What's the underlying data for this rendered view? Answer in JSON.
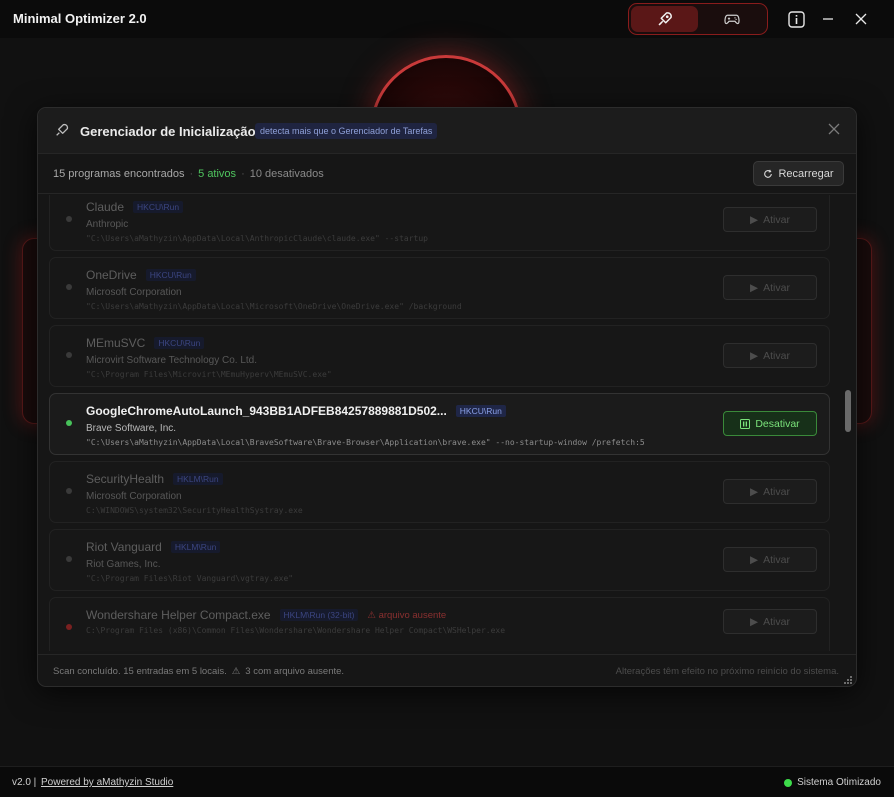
{
  "window": {
    "title": "Minimal Optimizer 2.0",
    "mode_icons": [
      "rocket-icon",
      "gamepad-icon"
    ],
    "window_controls": [
      "info-icon",
      "minimize-icon",
      "close-icon"
    ]
  },
  "modal": {
    "title": "Gerenciador de Inicialização",
    "tag": "detecta mais que o Gerenciador de Tarefas",
    "summary": {
      "found": "15 programas encontrados",
      "separator": "·",
      "active": "5 ativos",
      "inactive": "10 desativados"
    },
    "reload_label": "Recarregar",
    "items": [
      {
        "name": "Claude",
        "location": "HKCU\\Run",
        "vendor": "Anthropic",
        "path": "\"C:\\Users\\aMathyzin\\AppData\\Local\\AnthropicClaude\\claude.exe\" --startup",
        "enabled": false,
        "missing": false,
        "button": "Ativar"
      },
      {
        "name": "OneDrive",
        "location": "HKCU\\Run",
        "vendor": "Microsoft Corporation",
        "path": "\"C:\\Users\\aMathyzin\\AppData\\Local\\Microsoft\\OneDrive\\OneDrive.exe\" /background",
        "enabled": false,
        "missing": false,
        "button": "Ativar"
      },
      {
        "name": "MEmuSVC",
        "location": "HKCU\\Run",
        "vendor": "Microvirt Software Technology Co. Ltd.",
        "path": "\"C:\\Program Files\\Microvirt\\MEmuHyperv\\MEmuSVC.exe\"",
        "enabled": false,
        "missing": false,
        "button": "Ativar"
      },
      {
        "name": "GoogleChromeAutoLaunch_943BB1ADFEB84257889881D502...",
        "location": "HKCU\\Run",
        "vendor": "Brave Software, Inc.",
        "path": "\"C:\\Users\\aMathyzin\\AppData\\Local\\BraveSoftware\\Brave-Browser\\Application\\brave.exe\" --no-startup-window /prefetch:5",
        "enabled": true,
        "missing": false,
        "button": "Desativar"
      },
      {
        "name": "SecurityHealth",
        "location": "HKLM\\Run",
        "vendor": "Microsoft Corporation",
        "path": "C:\\WINDOWS\\system32\\SecurityHealthSystray.exe",
        "enabled": false,
        "missing": false,
        "button": "Ativar"
      },
      {
        "name": "Riot Vanguard",
        "location": "HKLM\\Run",
        "vendor": "Riot Games, Inc.",
        "path": "\"C:\\Program Files\\Riot Vanguard\\vgtray.exe\"",
        "enabled": false,
        "missing": false,
        "button": "Ativar"
      },
      {
        "name": "Wondershare Helper Compact.exe",
        "location": "HKLM\\Run (32-bit)",
        "vendor": "",
        "path": "C:\\Program Files (x86)\\Common Files\\Wondershare\\Wondershare Helper Compact\\WSHelper.exe",
        "enabled": false,
        "missing": true,
        "missing_label": "arquivo ausente",
        "button": "Ativar"
      }
    ],
    "scroll_fraction": 0.47,
    "footer": {
      "scan": "Scan concluído. 15 entradas em 5 locais.",
      "missing_count": "3 com arquivo ausente.",
      "note": "Alterações têm efeito no próximo reinício do sistema."
    }
  },
  "statusbar": {
    "version": "v2.0 |",
    "powered": "Powered by aMathyzin Studio",
    "status": "Sistema Otimizado",
    "status_color": "#3ddc4a"
  }
}
